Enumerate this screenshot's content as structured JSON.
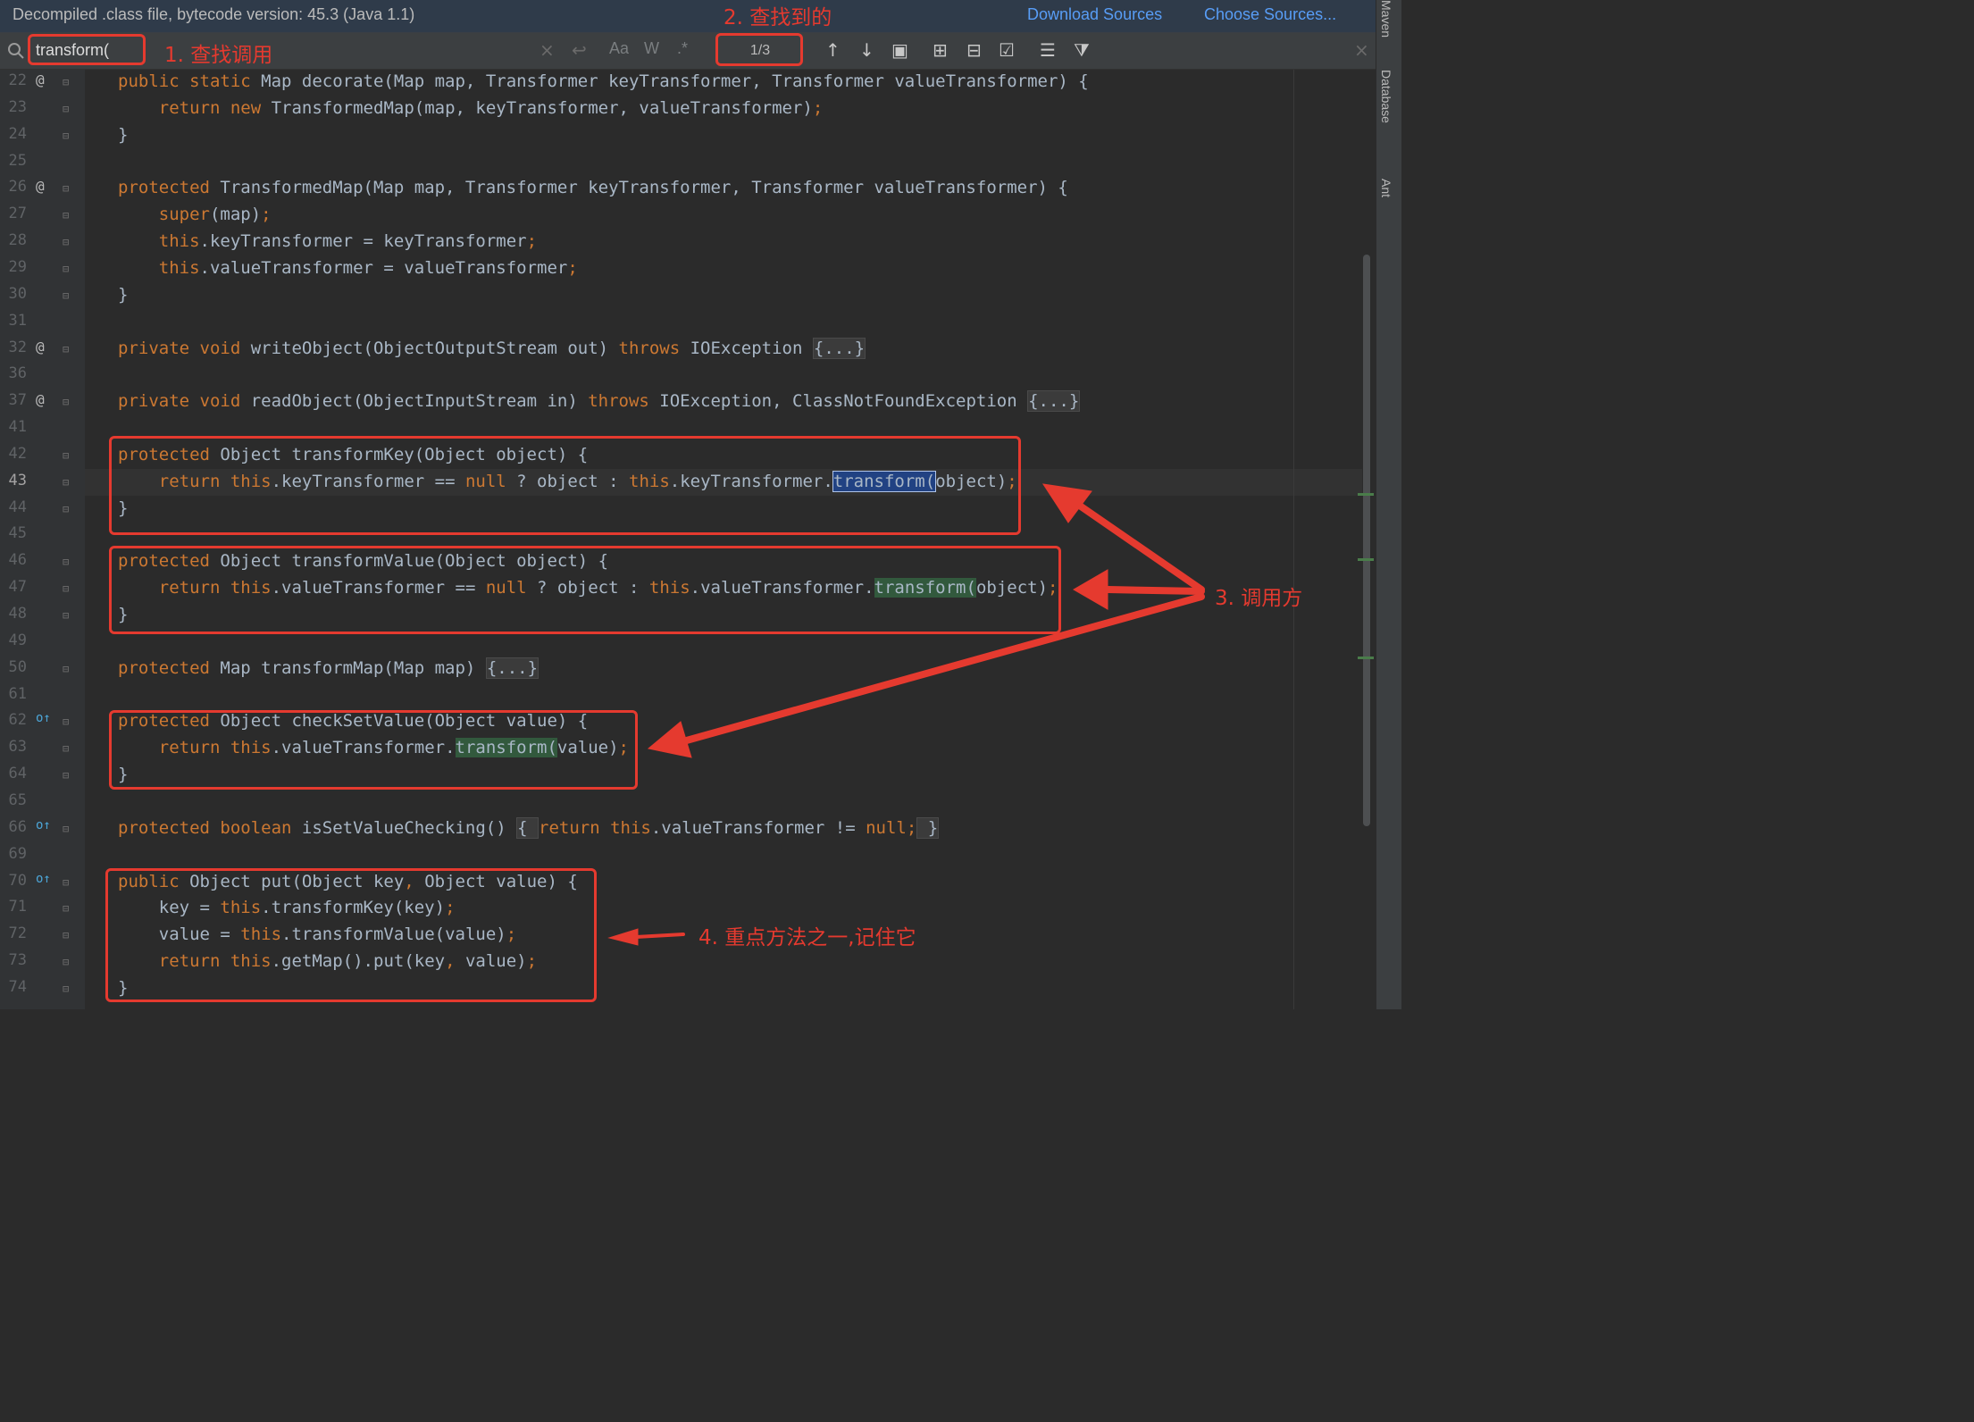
{
  "banner": {
    "title": "Decompiled .class file, bytecode version: 45.3 (Java 1.1)",
    "download_sources": "Download Sources",
    "choose_sources": "Choose Sources..."
  },
  "search": {
    "value": "transform(",
    "match_count": "1/3",
    "toolbar": {
      "case": "Aa",
      "words": "W",
      "regex": ".*"
    }
  },
  "side_tabs": {
    "maven": "Maven",
    "database": "Database",
    "ant": "Ant"
  },
  "annotations": {
    "step1": "1. 查找调用",
    "step2": "2. 查找到的",
    "step3": "3. 调用方",
    "step4": "4. 重点方法之一,记住它"
  },
  "code_lines": [
    {
      "n": "22",
      "mark": "@",
      "segments": [
        [
          "kw",
          "public static "
        ],
        [
          "p",
          "Map decorate(Map map, Transformer keyTransformer, Transformer valueTransformer) {"
        ]
      ]
    },
    {
      "n": "23",
      "mark": "",
      "segments": [
        [
          "p",
          "    "
        ],
        [
          "kw",
          "return new "
        ],
        [
          "p",
          "TransformedMap(map, keyTransformer, valueTransformer)"
        ],
        [
          "kw",
          ";"
        ]
      ]
    },
    {
      "n": "24",
      "mark": "",
      "segments": [
        [
          "p",
          "}"
        ]
      ]
    },
    {
      "n": "25",
      "mark": "",
      "segments": []
    },
    {
      "n": "26",
      "mark": "@",
      "segments": [
        [
          "kw",
          "protected "
        ],
        [
          "p",
          "TransformedMap(Map map, Transformer keyTransformer, Transformer valueTransformer) {"
        ]
      ]
    },
    {
      "n": "27",
      "mark": "",
      "segments": [
        [
          "p",
          "    "
        ],
        [
          "kw",
          "super"
        ],
        [
          "p",
          "(map)"
        ],
        [
          "kw",
          ";"
        ]
      ]
    },
    {
      "n": "28",
      "mark": "",
      "segments": [
        [
          "p",
          "    "
        ],
        [
          "kw",
          "this"
        ],
        [
          "p",
          ".keyTransformer = keyTransformer"
        ],
        [
          "kw",
          ";"
        ]
      ]
    },
    {
      "n": "29",
      "mark": "",
      "segments": [
        [
          "p",
          "    "
        ],
        [
          "kw",
          "this"
        ],
        [
          "p",
          ".valueTransformer = valueTransformer"
        ],
        [
          "kw",
          ";"
        ]
      ]
    },
    {
      "n": "30",
      "mark": "",
      "segments": [
        [
          "p",
          "}"
        ]
      ]
    },
    {
      "n": "31",
      "mark": "",
      "segments": []
    },
    {
      "n": "32",
      "mark": "@",
      "segments": [
        [
          "kw",
          "private void "
        ],
        [
          "p",
          "writeObject(ObjectOutputStream out) "
        ],
        [
          "kw",
          "throws "
        ],
        [
          "p",
          "IOException "
        ],
        [
          "fold",
          "{...}"
        ]
      ]
    },
    {
      "n": "36",
      "mark": "",
      "segments": []
    },
    {
      "n": "37",
      "mark": "@",
      "segments": [
        [
          "kw",
          "private void "
        ],
        [
          "p",
          "readObject(ObjectInputStream in) "
        ],
        [
          "kw",
          "throws "
        ],
        [
          "p",
          "IOException, ClassNotFoundException "
        ],
        [
          "fold",
          "{...}"
        ]
      ]
    },
    {
      "n": "41",
      "mark": "",
      "segments": []
    },
    {
      "n": "42",
      "mark": "",
      "segments": [
        [
          "kw",
          "protected "
        ],
        [
          "p",
          "Object transformKey(Object object) {"
        ]
      ]
    },
    {
      "n": "43",
      "mark": "",
      "segments": [
        [
          "p",
          "    "
        ],
        [
          "kw",
          "return this"
        ],
        [
          "p",
          ".keyTransformer == "
        ],
        [
          "kw",
          "null "
        ],
        [
          "p",
          "? object : "
        ],
        [
          "kw",
          "this"
        ],
        [
          "p",
          ".keyTransformer."
        ],
        [
          "sel",
          "transform("
        ],
        [
          "p",
          "object)"
        ],
        [
          "kw",
          ";"
        ]
      ]
    },
    {
      "n": "44",
      "mark": "",
      "segments": [
        [
          "p",
          "}"
        ]
      ]
    },
    {
      "n": "45",
      "mark": "",
      "segments": []
    },
    {
      "n": "46",
      "mark": "",
      "segments": [
        [
          "kw",
          "protected "
        ],
        [
          "p",
          "Object transformValue(Object object) {"
        ]
      ]
    },
    {
      "n": "47",
      "mark": "",
      "segments": [
        [
          "p",
          "    "
        ],
        [
          "kw",
          "return this"
        ],
        [
          "p",
          ".valueTransformer == "
        ],
        [
          "kw",
          "null "
        ],
        [
          "p",
          "? object : "
        ],
        [
          "kw",
          "this"
        ],
        [
          "p",
          ".valueTransformer."
        ],
        [
          "match",
          "transform("
        ],
        [
          "p",
          "object)"
        ],
        [
          "kw",
          ";"
        ]
      ]
    },
    {
      "n": "48",
      "mark": "",
      "segments": [
        [
          "p",
          "}"
        ]
      ]
    },
    {
      "n": "49",
      "mark": "",
      "segments": []
    },
    {
      "n": "50",
      "mark": "",
      "segments": [
        [
          "kw",
          "protected "
        ],
        [
          "p",
          "Map transformMap(Map map) "
        ],
        [
          "fold",
          "{...}"
        ]
      ]
    },
    {
      "n": "61",
      "mark": "",
      "segments": []
    },
    {
      "n": "62",
      "mark": "o↑",
      "segments": [
        [
          "kw",
          "protected "
        ],
        [
          "p",
          "Object checkSetValue(Object value) {"
        ]
      ]
    },
    {
      "n": "63",
      "mark": "",
      "segments": [
        [
          "p",
          "    "
        ],
        [
          "kw",
          "return this"
        ],
        [
          "p",
          ".valueTransformer."
        ],
        [
          "match",
          "transform("
        ],
        [
          "p",
          "value)"
        ],
        [
          "kw",
          ";"
        ]
      ]
    },
    {
      "n": "64",
      "mark": "",
      "segments": [
        [
          "p",
          "}"
        ]
      ]
    },
    {
      "n": "65",
      "mark": "",
      "segments": []
    },
    {
      "n": "66",
      "mark": "o↑",
      "segments": [
        [
          "kw",
          "protected boolean "
        ],
        [
          "p",
          "isSetValueChecking() "
        ],
        [
          "fold",
          "{ "
        ],
        [
          "kw",
          "return this"
        ],
        [
          "p",
          ".valueTransformer != "
        ],
        [
          "kw",
          "null;"
        ],
        [
          "fold",
          " }"
        ]
      ]
    },
    {
      "n": "69",
      "mark": "",
      "segments": []
    },
    {
      "n": "70",
      "mark": "o↑",
      "segments": [
        [
          "kw",
          "public "
        ],
        [
          "p",
          "Object put(Object key"
        ],
        [
          "kw",
          ", "
        ],
        [
          "p",
          "Object value) {"
        ]
      ]
    },
    {
      "n": "71",
      "mark": "",
      "segments": [
        [
          "p",
          "    key = "
        ],
        [
          "kw",
          "this"
        ],
        [
          "p",
          ".transformKey(key)"
        ],
        [
          "kw",
          ";"
        ]
      ]
    },
    {
      "n": "72",
      "mark": "",
      "segments": [
        [
          "p",
          "    value = "
        ],
        [
          "kw",
          "this"
        ],
        [
          "p",
          ".transformValue(value)"
        ],
        [
          "kw",
          ";"
        ]
      ]
    },
    {
      "n": "73",
      "mark": "",
      "segments": [
        [
          "p",
          "    "
        ],
        [
          "kw",
          "return this"
        ],
        [
          "p",
          ".getMap().put(key"
        ],
        [
          "kw",
          ", "
        ],
        [
          "p",
          "value)"
        ],
        [
          "kw",
          ";"
        ]
      ]
    },
    {
      "n": "74",
      "mark": "",
      "segments": [
        [
          "p",
          "}"
        ]
      ]
    }
  ]
}
